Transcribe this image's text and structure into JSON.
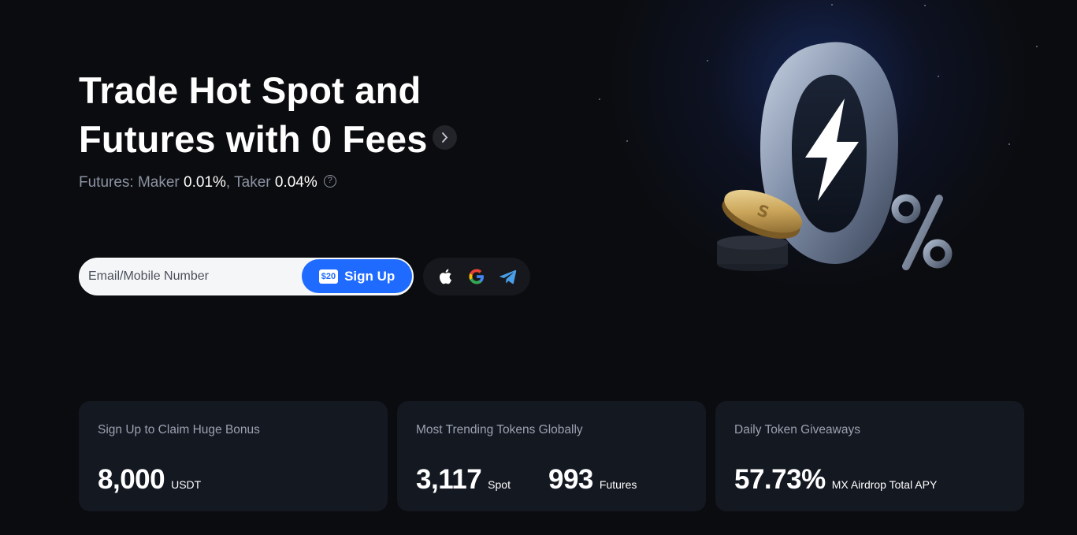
{
  "hero": {
    "title_line1": "Trade Hot Spot and",
    "title_line2": "Futures with 0 Fees",
    "fees_prefix": "Futures: Maker ",
    "maker_fee": "0.01%",
    "fees_sep": ", Taker ",
    "taker_fee": "0.04%"
  },
  "signup": {
    "placeholder": "Email/Mobile Number",
    "value": "",
    "bonus_badge": "$20",
    "button_label": "Sign Up"
  },
  "social": {
    "icons": [
      "apple-icon",
      "google-icon",
      "telegram-icon"
    ]
  },
  "illustration": {
    "big_text": "0",
    "percent_text": "%"
  },
  "cards": [
    {
      "title": "Sign Up to Claim Huge Bonus",
      "stats": [
        {
          "value": "8,000",
          "unit": "USDT"
        }
      ]
    },
    {
      "title": "Most Trending Tokens Globally",
      "stats": [
        {
          "value": "3,117",
          "unit": "Spot"
        },
        {
          "value": "993",
          "unit": "Futures"
        }
      ]
    },
    {
      "title": "Daily Token Giveaways",
      "stats": [
        {
          "value": "57.73%",
          "unit": "MX Airdrop Total APY"
        }
      ]
    }
  ],
  "colors": {
    "background": "#0b0c0f",
    "accent": "#1f6bff",
    "card": "#141821",
    "muted_text": "#8c93a3"
  }
}
